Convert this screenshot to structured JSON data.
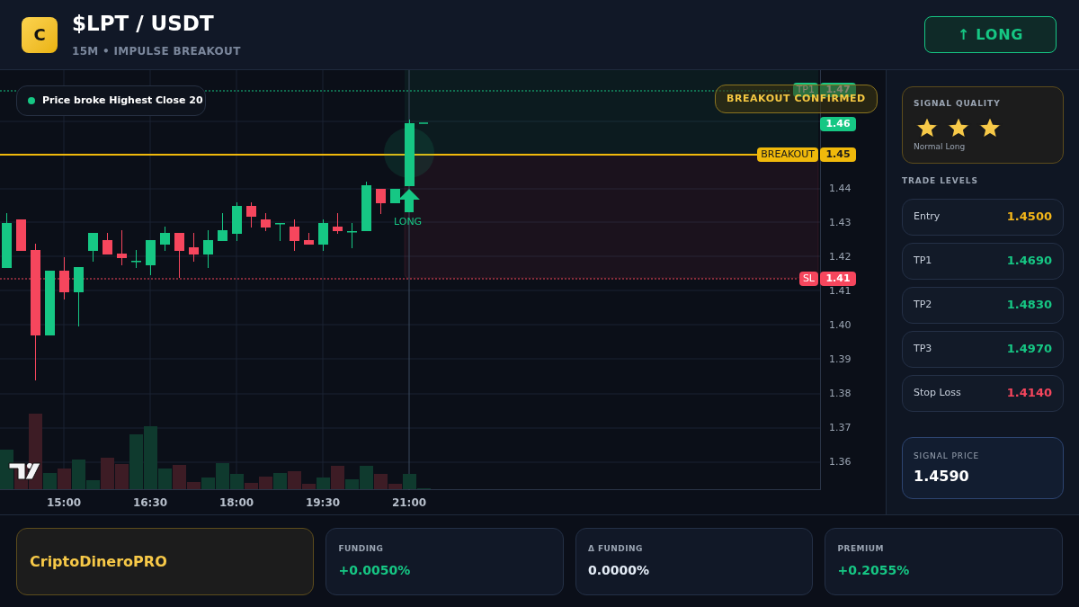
{
  "header": {
    "logo": "C",
    "title": "$LPT / USDT",
    "subtitle": "15M • IMPULSE BREAKOUT",
    "direction_button": "↑ LONG"
  },
  "chart": {
    "alert": "Price broke Highest Close 20",
    "banner": "BREAKOUT CONFIRMED",
    "signal_marker": "LONG",
    "price_labels": [
      {
        "kind": "tp",
        "tag": "TP1",
        "value": "1.47"
      },
      {
        "kind": "current",
        "value": "1.46"
      },
      {
        "kind": "breakout",
        "tag": "BREAKOUT",
        "value": "1.45"
      },
      {
        "kind": "sl",
        "tag": "SL",
        "value": "1.41"
      }
    ],
    "price_axis": [
      "1.44",
      "1.43",
      "1.42",
      "1.41",
      "1.40",
      "1.39",
      "1.38",
      "1.37",
      "1.36"
    ],
    "time_axis": [
      "15:00",
      "16:30",
      "18:00",
      "19:30",
      "21:00"
    ]
  },
  "sidebar": {
    "quality": {
      "label": "SIGNAL QUALITY",
      "stars": 3,
      "caption": "Normal Long"
    },
    "levels_title": "TRADE LEVELS",
    "levels": [
      {
        "kind": "entry",
        "label": "Entry",
        "value": "1.4500"
      },
      {
        "kind": "tp",
        "label": "TP1",
        "value": "1.4690"
      },
      {
        "kind": "tp",
        "label": "TP2",
        "value": "1.4830"
      },
      {
        "kind": "tp",
        "label": "TP3",
        "value": "1.4970"
      },
      {
        "kind": "sl",
        "label": "Stop Loss",
        "value": "1.4140"
      }
    ],
    "signal_price": {
      "label": "SIGNAL PRICE",
      "value": "1.4590"
    }
  },
  "footer": {
    "brand": "CriptoDineroPRO",
    "metrics": [
      {
        "kind": "positive",
        "label": "FUNDING",
        "value": "+0.0050%"
      },
      {
        "kind": "neutral",
        "label": "Δ FUNDING",
        "value": "0.0000%"
      },
      {
        "kind": "positive",
        "label": "PREMIUM",
        "value": "+0.2055%"
      }
    ]
  }
}
